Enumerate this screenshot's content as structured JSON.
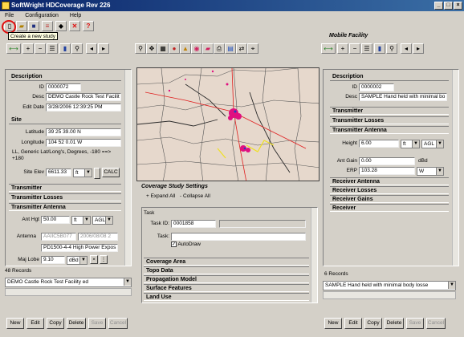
{
  "window": {
    "title": "SoftWright HDCoverage Rev 226",
    "min": "_",
    "max": "□",
    "close": "×"
  },
  "menu": [
    "File",
    "Configuration",
    "Help"
  ],
  "tooltip": "Create a new study",
  "study_settings_title": "Coverage Study Settings",
  "mobile_facility_title": "Mobile Facility",
  "expand_all": "+ Expand All",
  "collapse_all": "- Collapse All",
  "left": {
    "description_header": "Description",
    "id_label": "ID",
    "id": "0000072",
    "desc_label": "Desc",
    "desc": "DEMO Castle Rock Test Facilit",
    "edit_date_label": "Edit Date",
    "edit_date": "3/28/2006 12:39:25 PM",
    "site_header": "Site",
    "lat_label": "Latitude",
    "lat": "39 25 39.00 N",
    "lon_label": "Longitude",
    "lon": "104 52 0.01 W",
    "ll_note": "LL, Generic Lat/Long's, Degrees, -180 ==> +180",
    "site_elev_label": "Site Elev",
    "site_elev": "6611.33",
    "site_elev_unit": "ft",
    "calc": "CALC",
    "transmitter": "Transmitter",
    "transmitter_losses": "Transmitter Losses",
    "transmitter_antenna": "Transmitter Antenna",
    "ant_hgt_label": "Ant Hgt",
    "ant_hgt": "50.00",
    "ant_hgt_unit": "ft",
    "ant_hgt_ref": "AGL",
    "antenna_label": "Antenna",
    "antenna_a": "AAIIC5B077",
    "antenna_b": "2006/08/08 2",
    "antenna_desc": "PD1500-4-4 High Power Expos",
    "maj_lobe_label": "Maj Lobe",
    "maj_lobe": "9.10",
    "maj_lobe_unit": "dBd",
    "records": "48 Records",
    "record_select": "DEMO Castle Rock Test Facility ed",
    "buttons": [
      "New",
      "Edit",
      "Copy",
      "Delete",
      "Save",
      "Cancel"
    ]
  },
  "task": {
    "title": "Task",
    "task_id_label": "Task ID:",
    "task_id": "0001858",
    "task_label": "Task:",
    "autodraw": "AutoDraw",
    "sections": [
      "Coverage Area",
      "Topo Data",
      "Propagation Model",
      "Surface Features",
      "Land Use"
    ]
  },
  "right": {
    "description_header": "Description",
    "id_label": "ID",
    "id": "0000002",
    "desc_label": "Desc",
    "desc": "SAMPLE Hand held with minimal bo",
    "transmitter": "Transmitter",
    "transmitter_losses": "Transmitter Losses",
    "transmitter_antenna": "Transmitter Antenna",
    "height_label": "Height",
    "height": "6.00",
    "height_unit": "ft",
    "height_ref": "AGL",
    "ant_gain_label": "Ant Gain",
    "ant_gain": "0.00",
    "ant_gain_unit": "dBd",
    "erp_label": "ERP",
    "erp": "103.28",
    "erp_unit": "W",
    "receiver_antenna": "Receiver Antenna",
    "receiver_losses": "Receiver Losses",
    "receiver_gains": "Receiver Gains",
    "receiver": "Receiver",
    "records": "6 Records",
    "record_select": "SAMPLE Hand held with minimal body losse",
    "buttons": [
      "New",
      "Edit",
      "Copy",
      "Delete",
      "Save",
      "Cancel"
    ]
  },
  "colors": {
    "title_bar": "#0a246a",
    "highlight": "#e01010",
    "map_bg": "#e0d0c8"
  }
}
